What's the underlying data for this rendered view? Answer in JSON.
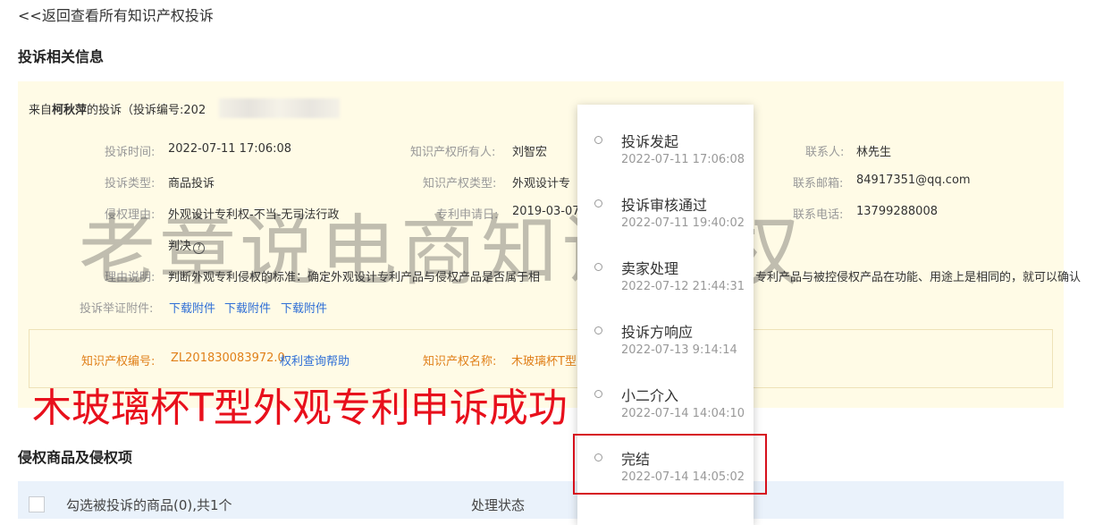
{
  "back_link": "<<返回查看所有知识产权投诉",
  "section1_title": "投诉相关信息",
  "complaint_from": {
    "prefix": "来自",
    "name": "柯秋萍",
    "suffix": "的投诉（投诉编号:202"
  },
  "fields": {
    "complaint_time": {
      "label": "投诉时间:",
      "value": "2022-07-11 17:06:08"
    },
    "complaint_type": {
      "label": "投诉类型:",
      "value": "商品投诉"
    },
    "infringe_reason": {
      "label": "侵权理由:",
      "value": "外观设计专利权-不当-无司法行政",
      "value2": "判决"
    },
    "reason_desc": {
      "label": "理由说明:",
      "value": "判断外观专利侵权的标准：确定外观设计专利产品与侵权产品是否属于相",
      "value_tail": "专利产品与被控侵权产品在功能、用途上是相同的，就可以确认"
    },
    "evidence": {
      "label": "投诉举证附件:",
      "links": [
        "下载附件",
        "下载附件",
        "下载附件"
      ]
    },
    "ip_owner": {
      "label": "知识产权所有人:",
      "value": "刘智宏"
    },
    "ip_type": {
      "label": "知识产权类型:",
      "value": "外观设计专"
    },
    "patent_date": {
      "label": "专利申请日:",
      "value": "2019-03-07"
    },
    "contact": {
      "label": "联系人:",
      "value": "林先生"
    },
    "email": {
      "label": "联系邮箱:",
      "value": "84917351@qq.com"
    },
    "phone": {
      "label": "联系电话:",
      "value": "13799288008"
    }
  },
  "ip_box": {
    "number_label": "知识产权编号:",
    "number_value": "ZL201830083972.0",
    "query_help": "权利查询帮助",
    "name_label": "知识产权名称:",
    "name_value": "木玻璃杯T型"
  },
  "watermark": "老章说电商知识产权",
  "red_caption": "木玻璃杯T型外观专利申诉成功",
  "section2_title": "侵权商品及侵权项",
  "table_header": {
    "select_label": "勾选被投诉的商品(0),共1个",
    "status_label": "处理状态"
  },
  "timeline": [
    {
      "title": "投诉发起",
      "time": "2022-07-11 17:06:08"
    },
    {
      "title": "投诉审核通过",
      "time": "2022-07-11 19:40:02"
    },
    {
      "title": "卖家处理",
      "time": "2022-07-12 21:44:31"
    },
    {
      "title": "投诉方响应",
      "time": "2022-07-13 9:14:14"
    },
    {
      "title": "小二介入",
      "time": "2022-07-14 14:04:10"
    },
    {
      "title": "完结",
      "time": "2022-07-14 14:05:02"
    }
  ],
  "colors": {
    "panel_bg": "#fffbe6",
    "link": "#2f6fd6",
    "orange": "#e0801a",
    "highlight_red": "#d6101c"
  }
}
